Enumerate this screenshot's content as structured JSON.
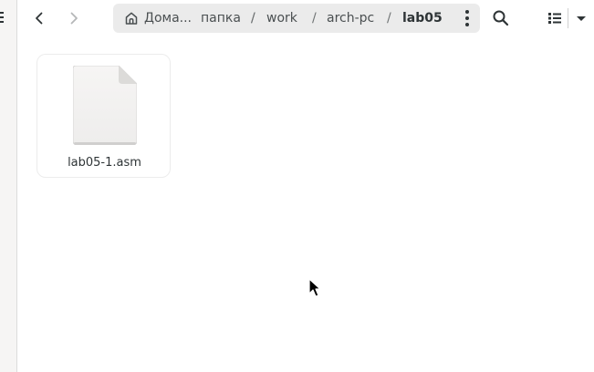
{
  "header": {
    "breadcrumbs": [
      "Дома...",
      "папка",
      "work",
      "arch-pc",
      "lab05"
    ],
    "separator": "/"
  },
  "icons": {
    "sidebar_toggle": "hamburger-icon",
    "back": "chevron-left-icon",
    "forward": "chevron-right-icon",
    "home": "home-icon",
    "menu": "kebab-menu-icon",
    "search": "search-icon",
    "view": "list-view-icon",
    "view_dropdown": "caret-down-icon"
  },
  "files": [
    {
      "name": "lab05-1.asm",
      "icon": "text-file-icon"
    }
  ],
  "colors": {
    "pathbar_bg": "#ebebeb",
    "sidebar_bg": "#f6f5f4",
    "text": "#2e3436"
  }
}
